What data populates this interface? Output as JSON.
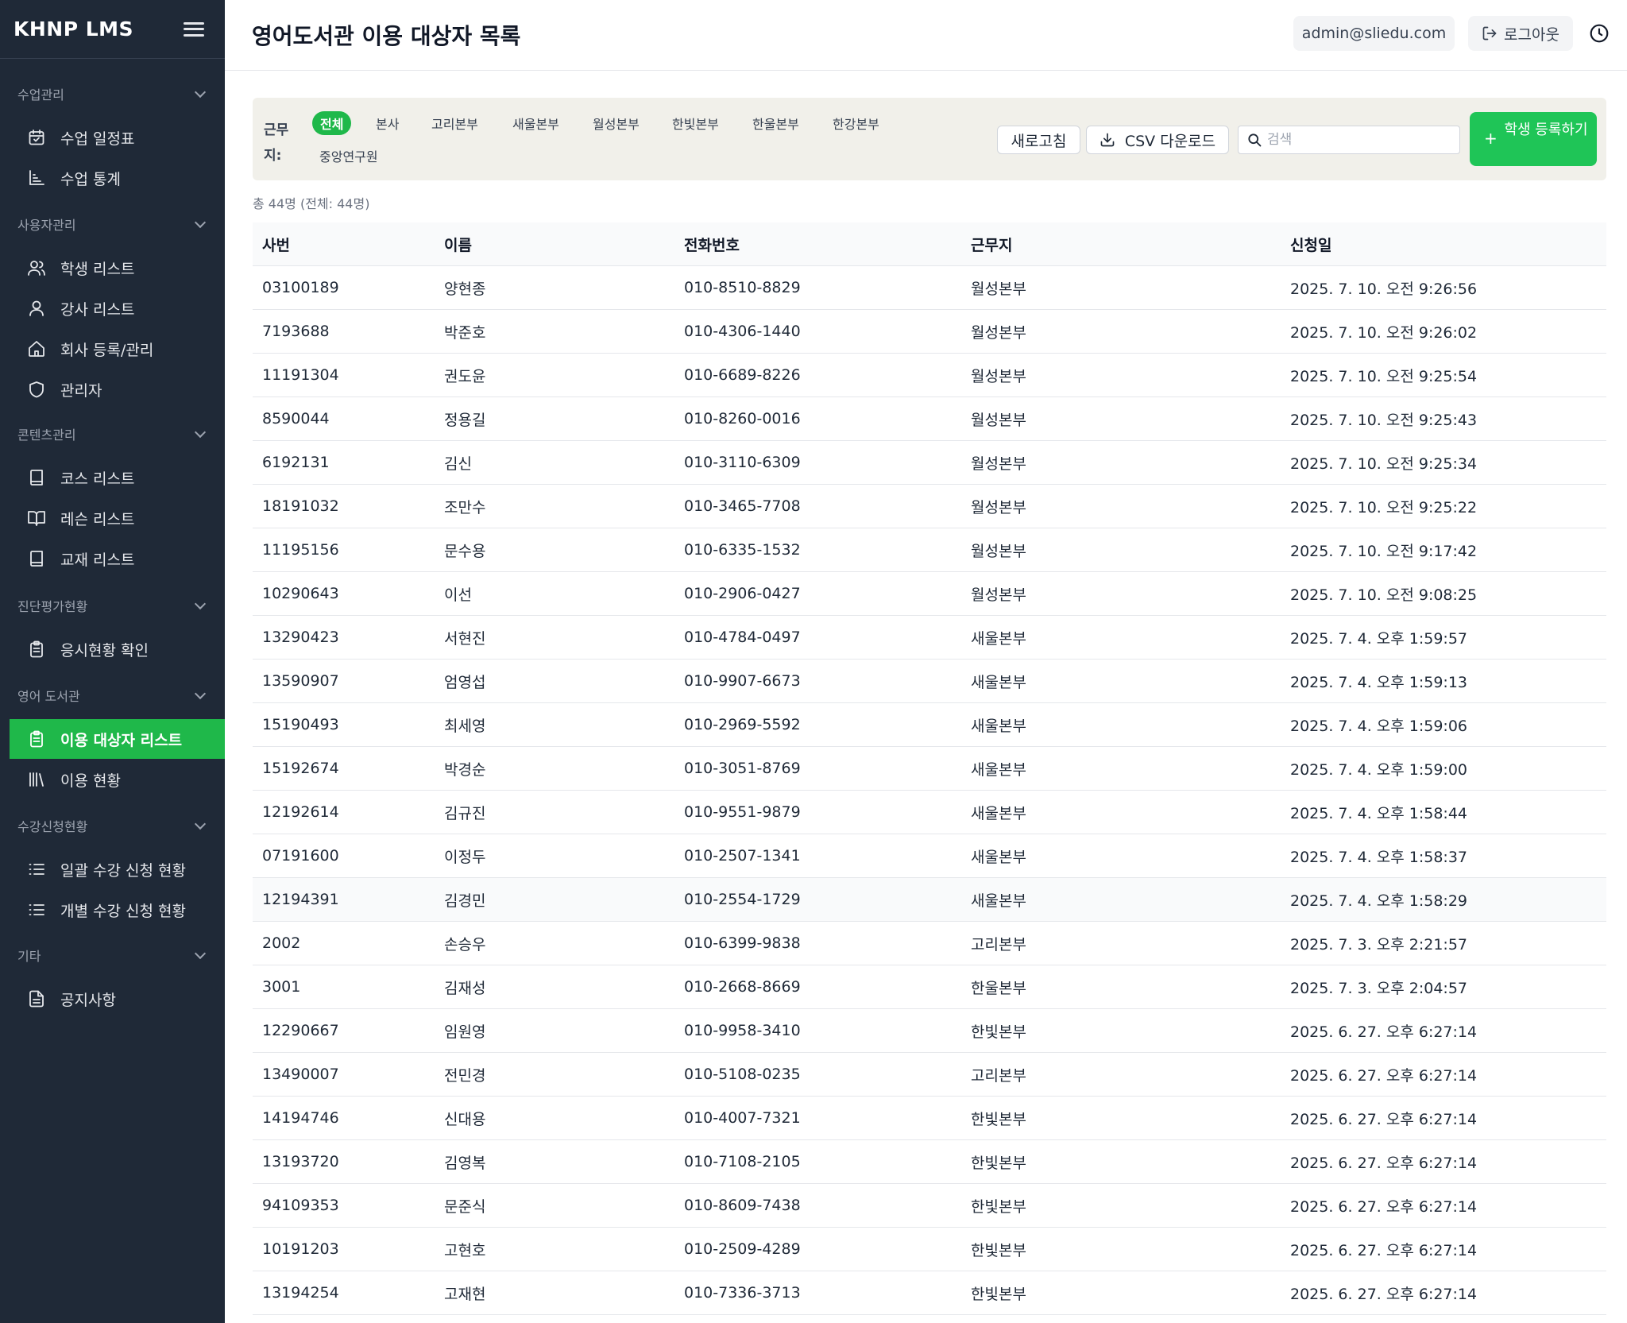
{
  "sidebar": {
    "brand": "KHNP LMS",
    "sections": [
      {
        "title": "수업관리",
        "items": [
          {
            "label": "수업 일정표",
            "icon": "calendar-icon"
          },
          {
            "label": "수업 통계",
            "icon": "chart-icon"
          }
        ]
      },
      {
        "title": "사용자관리",
        "items": [
          {
            "label": "학생 리스트",
            "icon": "users-icon"
          },
          {
            "label": "강사 리스트",
            "icon": "user-icon"
          },
          {
            "label": "회사 등록/관리",
            "icon": "home-icon"
          },
          {
            "label": "관리자",
            "icon": "shield-icon"
          }
        ]
      },
      {
        "title": "콘텐츠관리",
        "items": [
          {
            "label": "코스 리스트",
            "icon": "book-icon"
          },
          {
            "label": "레슨 리스트",
            "icon": "book-open-icon"
          },
          {
            "label": "교재 리스트",
            "icon": "book-icon"
          }
        ]
      },
      {
        "title": "진단평가현황",
        "items": [
          {
            "label": "응시현황 확인",
            "icon": "clipboard-icon"
          }
        ]
      },
      {
        "title": "영어 도서관",
        "items": [
          {
            "label": "이용 대상자 리스트",
            "icon": "clipboard-icon",
            "active": true
          },
          {
            "label": "이용 현황",
            "icon": "library-icon"
          }
        ]
      },
      {
        "title": "수강신청현황",
        "items": [
          {
            "label": "일괄 수강 신청 현황",
            "icon": "list-icon"
          },
          {
            "label": "개별 수강 신청 현황",
            "icon": "list-icon"
          }
        ]
      },
      {
        "title": "기타",
        "items": [
          {
            "label": "공지사항",
            "icon": "file-text-icon"
          }
        ]
      }
    ]
  },
  "header": {
    "title": "영어도서관 이용 대상자 목록",
    "email": "admin@sliedu.com",
    "logout": "로그아웃"
  },
  "filters": {
    "label_line1": "근무",
    "label_line2": "지:",
    "chips": [
      "전체",
      "본사",
      "고리본부",
      "새울본부",
      "월성본부",
      "한빛본부",
      "한울본부",
      "한강본부",
      "중앙연구원"
    ],
    "active_chip": "전체"
  },
  "actions": {
    "refresh": "새로고침",
    "csv": "CSV 다운로드",
    "search_placeholder": "검색",
    "register_plus": "+",
    "register": "학생 등록하기"
  },
  "total_text": "총 44명 (전체: 44명)",
  "table": {
    "columns": [
      "사번",
      "이름",
      "전화번호",
      "근무지",
      "신청일"
    ],
    "rows": [
      [
        "03100189",
        "양현종",
        "010-8510-8829",
        "월성본부",
        "2025. 7. 10. 오전 9:26:56"
      ],
      [
        "7193688",
        "박준호",
        "010-4306-1440",
        "월성본부",
        "2025. 7. 10. 오전 9:26:02"
      ],
      [
        "11191304",
        "권도윤",
        "010-6689-8226",
        "월성본부",
        "2025. 7. 10. 오전 9:25:54"
      ],
      [
        "8590044",
        "정용길",
        "010-8260-0016",
        "월성본부",
        "2025. 7. 10. 오전 9:25:43"
      ],
      [
        "6192131",
        "김신",
        "010-3110-6309",
        "월성본부",
        "2025. 7. 10. 오전 9:25:34"
      ],
      [
        "18191032",
        "조만수",
        "010-3465-7708",
        "월성본부",
        "2025. 7. 10. 오전 9:25:22"
      ],
      [
        "11195156",
        "문수용",
        "010-6335-1532",
        "월성본부",
        "2025. 7. 10. 오전 9:17:42"
      ],
      [
        "10290643",
        "이선",
        "010-2906-0427",
        "월성본부",
        "2025. 7. 10. 오전 9:08:25"
      ],
      [
        "13290423",
        "서현진",
        "010-4784-0497",
        "새울본부",
        "2025. 7. 4. 오후 1:59:57"
      ],
      [
        "13590907",
        "엄영섭",
        "010-9907-6673",
        "새울본부",
        "2025. 7. 4. 오후 1:59:13"
      ],
      [
        "15190493",
        "최세영",
        "010-2969-5592",
        "새울본부",
        "2025. 7. 4. 오후 1:59:06"
      ],
      [
        "15192674",
        "박경순",
        "010-3051-8769",
        "새울본부",
        "2025. 7. 4. 오후 1:59:00"
      ],
      [
        "12192614",
        "김규진",
        "010-9551-9879",
        "새울본부",
        "2025. 7. 4. 오후 1:58:44"
      ],
      [
        "07191600",
        "이정두",
        "010-2507-1341",
        "새울본부",
        "2025. 7. 4. 오후 1:58:37"
      ],
      [
        "12194391",
        "김경민",
        "010-2554-1729",
        "새울본부",
        "2025. 7. 4. 오후 1:58:29"
      ],
      [
        "2002",
        "손승우",
        "010-6399-9838",
        "고리본부",
        "2025. 7. 3. 오후 2:21:57"
      ],
      [
        "3001",
        "김재성",
        "010-2668-8669",
        "한울본부",
        "2025. 7. 3. 오후 2:04:57"
      ],
      [
        "12290667",
        "임원영",
        "010-9958-3410",
        "한빛본부",
        "2025. 6. 27. 오후 6:27:14"
      ],
      [
        "13490007",
        "전민경",
        "010-5108-0235",
        "고리본부",
        "2025. 6. 27. 오후 6:27:14"
      ],
      [
        "14194746",
        "신대용",
        "010-4007-7321",
        "한빛본부",
        "2025. 6. 27. 오후 6:27:14"
      ],
      [
        "13193720",
        "김영복",
        "010-7108-2105",
        "한빛본부",
        "2025. 6. 27. 오후 6:27:14"
      ],
      [
        "94109353",
        "문준식",
        "010-8609-7438",
        "한빛본부",
        "2025. 6. 27. 오후 6:27:14"
      ],
      [
        "10191203",
        "고현호",
        "010-2509-4289",
        "한빛본부",
        "2025. 6. 27. 오후 6:27:14"
      ],
      [
        "13194254",
        "고재현",
        "010-7336-3713",
        "한빛본부",
        "2025. 6. 27. 오후 6:27:14"
      ]
    ],
    "hover_row": 14
  },
  "colors": {
    "sidebar_bg": "#1f2937",
    "accent_green": "#1fb84a",
    "filter_bg": "#f1f0ea"
  }
}
